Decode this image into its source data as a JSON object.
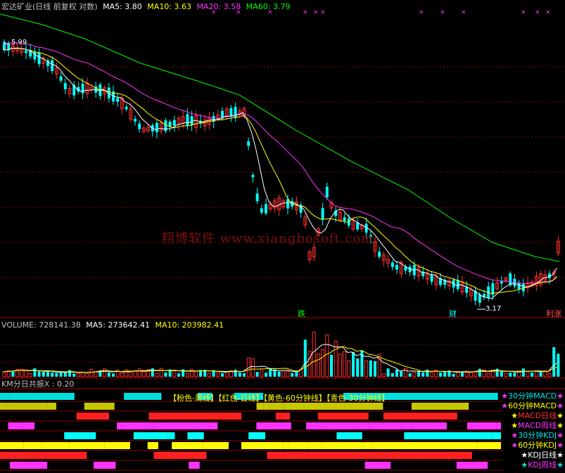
{
  "main_header": {
    "title": "宏达矿业(日线 前复权 对数)",
    "ma5": "MA5: 3.80",
    "ma10": "MA10: 3.63",
    "ma20": "MA20: 3.58",
    "ma60": "MA60: 3.79"
  },
  "price_annotations": {
    "high": "5.99",
    "low": "3.17"
  },
  "watermark": "翔博软件  www.xiangbosoft.com",
  "event_markers": [
    "跌",
    "财",
    "利涨"
  ],
  "volume_header": {
    "volume": "VOLUME: 728141.38",
    "ma5": "MA5: 273642.41",
    "ma10": "MA10: 203982.41"
  },
  "indicator_header": {
    "label": "KM分日共振X : 0.20"
  },
  "indicator_legend": "【粉色-周线】【红色-日线】【黄色-60分钟线】【青色-30分钟线】",
  "side_labels": [
    {
      "text": "30分钟MACD",
      "color": "#00e0e0",
      "star": "#ff33ff"
    },
    {
      "text": "60分钟MACD",
      "color": "#ffff00",
      "star": "#ff33ff"
    },
    {
      "text": "MACD日线",
      "color": "#ff3030",
      "star": "#ffff00"
    },
    {
      "text": "MACD周线",
      "color": "#ff33ff",
      "star": "#ffff00"
    },
    {
      "text": "30分钟KDJ",
      "color": "#00e0e0",
      "star": "#ff33ff"
    },
    {
      "text": "60分钟KDJ",
      "color": "#ffff00",
      "star": "#ff33ff"
    },
    {
      "text": "KDJ日线",
      "color": "#ffffff",
      "star": "#ffffff"
    },
    {
      "text": "KDJ周线",
      "color": "#ff33ff",
      "star": "#00e0e0"
    }
  ],
  "colors": {
    "ma5": "#ffffff",
    "ma10": "#ffff00",
    "ma20": "#ff33ff",
    "ma60": "#00ff00",
    "up": "#ff3030",
    "down": "#00ffff",
    "grid": "#8b0000"
  }
}
